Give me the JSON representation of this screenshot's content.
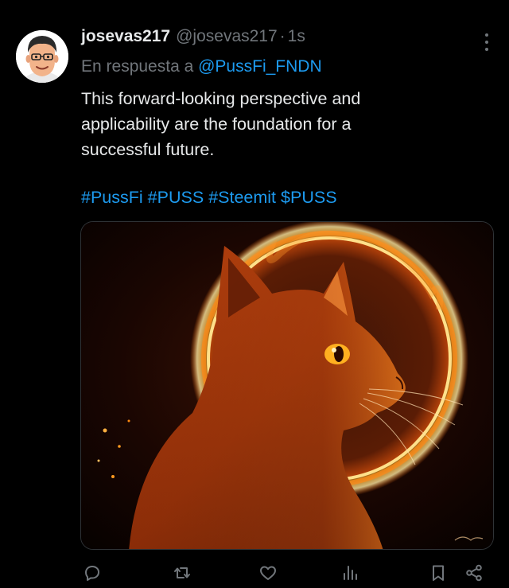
{
  "tweet": {
    "display_name": "josevas217",
    "handle": "@josevas217",
    "separator": "·",
    "time": "1s",
    "reply_prefix": "En respuesta a",
    "reply_to": "@PussFi_FNDN",
    "text_lines": [
      "This forward-looking perspective and",
      "applicability are the foundation for a",
      "successful future."
    ],
    "hashtags": [
      "#PussFi",
      "#PUSS",
      "#Steemit",
      "$PUSS"
    ],
    "media_description_icon": "cat-eclipse-image"
  },
  "actions": [
    {
      "icon": "reply-icon"
    },
    {
      "icon": "retweet-icon"
    },
    {
      "icon": "like-icon"
    },
    {
      "icon": "views-icon"
    },
    {
      "icon": "bookmark-icon"
    },
    {
      "icon": "share-icon"
    }
  ],
  "colors": {
    "background": "#000000",
    "text": "#e7e9ea",
    "muted": "#71767b",
    "accent": "#1d9bf0"
  }
}
